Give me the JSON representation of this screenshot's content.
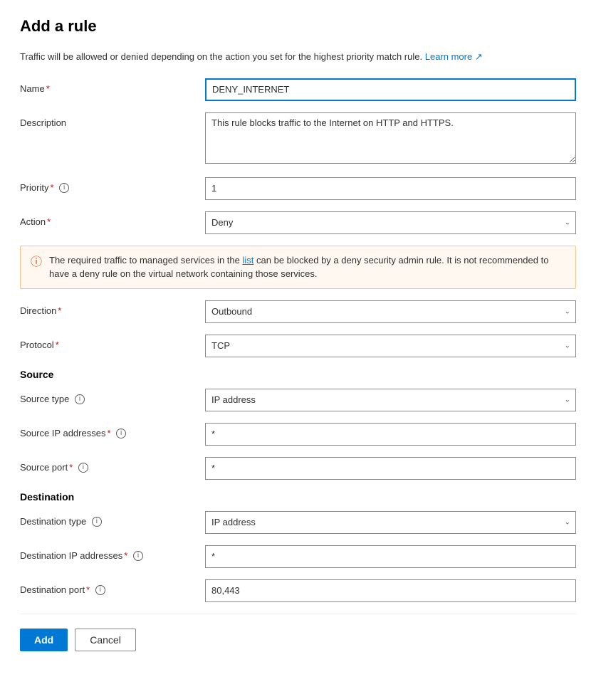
{
  "page": {
    "title": "Add a rule",
    "info_text": "Traffic will be allowed or denied depending on the action you set for the highest priority match rule.",
    "learn_more_label": "Learn more",
    "learn_more_icon": "↗"
  },
  "form": {
    "name": {
      "label": "Name",
      "required": true,
      "value": "DENY_INTERNET"
    },
    "description": {
      "label": "Description",
      "required": false,
      "value": "This rule blocks traffic to the Internet on HTTP and HTTPS."
    },
    "priority": {
      "label": "Priority",
      "required": true,
      "info": true,
      "value": "1"
    },
    "action": {
      "label": "Action",
      "required": true,
      "value": "Deny"
    },
    "warning": {
      "text": "The required traffic to managed services in the",
      "link_text": "list",
      "text2": "can be blocked by a deny security admin rule. It is not recommended to have a deny rule on the virtual network containing those services."
    },
    "direction": {
      "label": "Direction",
      "required": true,
      "value": "Outbound"
    },
    "protocol": {
      "label": "Protocol",
      "required": true,
      "value": "TCP"
    },
    "source_section": "Source",
    "source_type": {
      "label": "Source type",
      "info": true,
      "value": "IP address"
    },
    "source_ip": {
      "label": "Source IP addresses",
      "required": true,
      "info": true,
      "value": "*"
    },
    "source_port": {
      "label": "Source port",
      "required": true,
      "info": true,
      "value": "*"
    },
    "destination_section": "Destination",
    "destination_type": {
      "label": "Destination type",
      "info": true,
      "value": "IP address"
    },
    "destination_ip": {
      "label": "Destination IP addresses",
      "required": true,
      "info": true,
      "value": "*"
    },
    "destination_port": {
      "label": "Destination port",
      "required": true,
      "info": true,
      "value": "80,443"
    }
  },
  "buttons": {
    "add": "Add",
    "cancel": "Cancel"
  }
}
